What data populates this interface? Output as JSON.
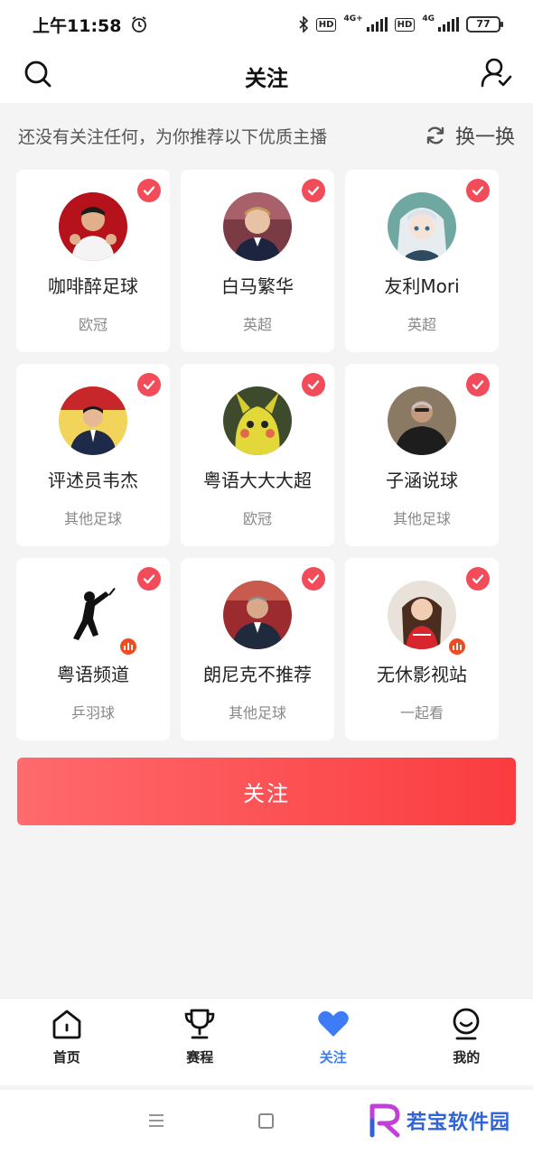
{
  "status_bar": {
    "time": "上午11:58",
    "hd1": "HD",
    "net1": "4G+",
    "hd2": "HD",
    "net2": "4G",
    "battery": "77"
  },
  "header": {
    "title": "关注",
    "search_icon": "search-icon",
    "user_icon": "user-check-icon"
  },
  "hint": {
    "text": "还没有关注任何，为你推荐以下优质主播",
    "refresh_label": "换一换"
  },
  "streamers": [
    {
      "name": "咖啡醉足球",
      "tag": "欧冠",
      "checked": true,
      "live": false
    },
    {
      "name": "白马繁华",
      "tag": "英超",
      "checked": true,
      "live": false
    },
    {
      "name": "友利Mori",
      "tag": "英超",
      "checked": true,
      "live": false
    },
    {
      "name": "评述员韦杰",
      "tag": "其他足球",
      "checked": true,
      "live": false
    },
    {
      "name": "粤语大大大超",
      "tag": "欧冠",
      "checked": true,
      "live": false
    },
    {
      "name": "子涵说球",
      "tag": "其他足球",
      "checked": true,
      "live": false
    },
    {
      "name": "粤语频道",
      "tag": "乒羽球",
      "checked": true,
      "live": true
    },
    {
      "name": "朗尼克不推荐",
      "tag": "其他足球",
      "checked": true,
      "live": false
    },
    {
      "name": "无休影视站",
      "tag": "一起看",
      "checked": true,
      "live": true
    }
  ],
  "follow_button": {
    "label": "关注"
  },
  "bottom_nav": [
    {
      "label": "首页",
      "icon": "home-icon",
      "active": false
    },
    {
      "label": "赛程",
      "icon": "trophy-icon",
      "active": false
    },
    {
      "label": "关注",
      "icon": "heart-icon",
      "active": true
    },
    {
      "label": "我的",
      "icon": "profile-icon",
      "active": false
    }
  ],
  "watermark": {
    "text": "若宝软件园"
  },
  "colors": {
    "accent_red": "#f24b5a",
    "active_blue": "#3d7bf7",
    "button_gradient_start": "#ff6a6d",
    "button_gradient_end": "#fa3c3f"
  }
}
